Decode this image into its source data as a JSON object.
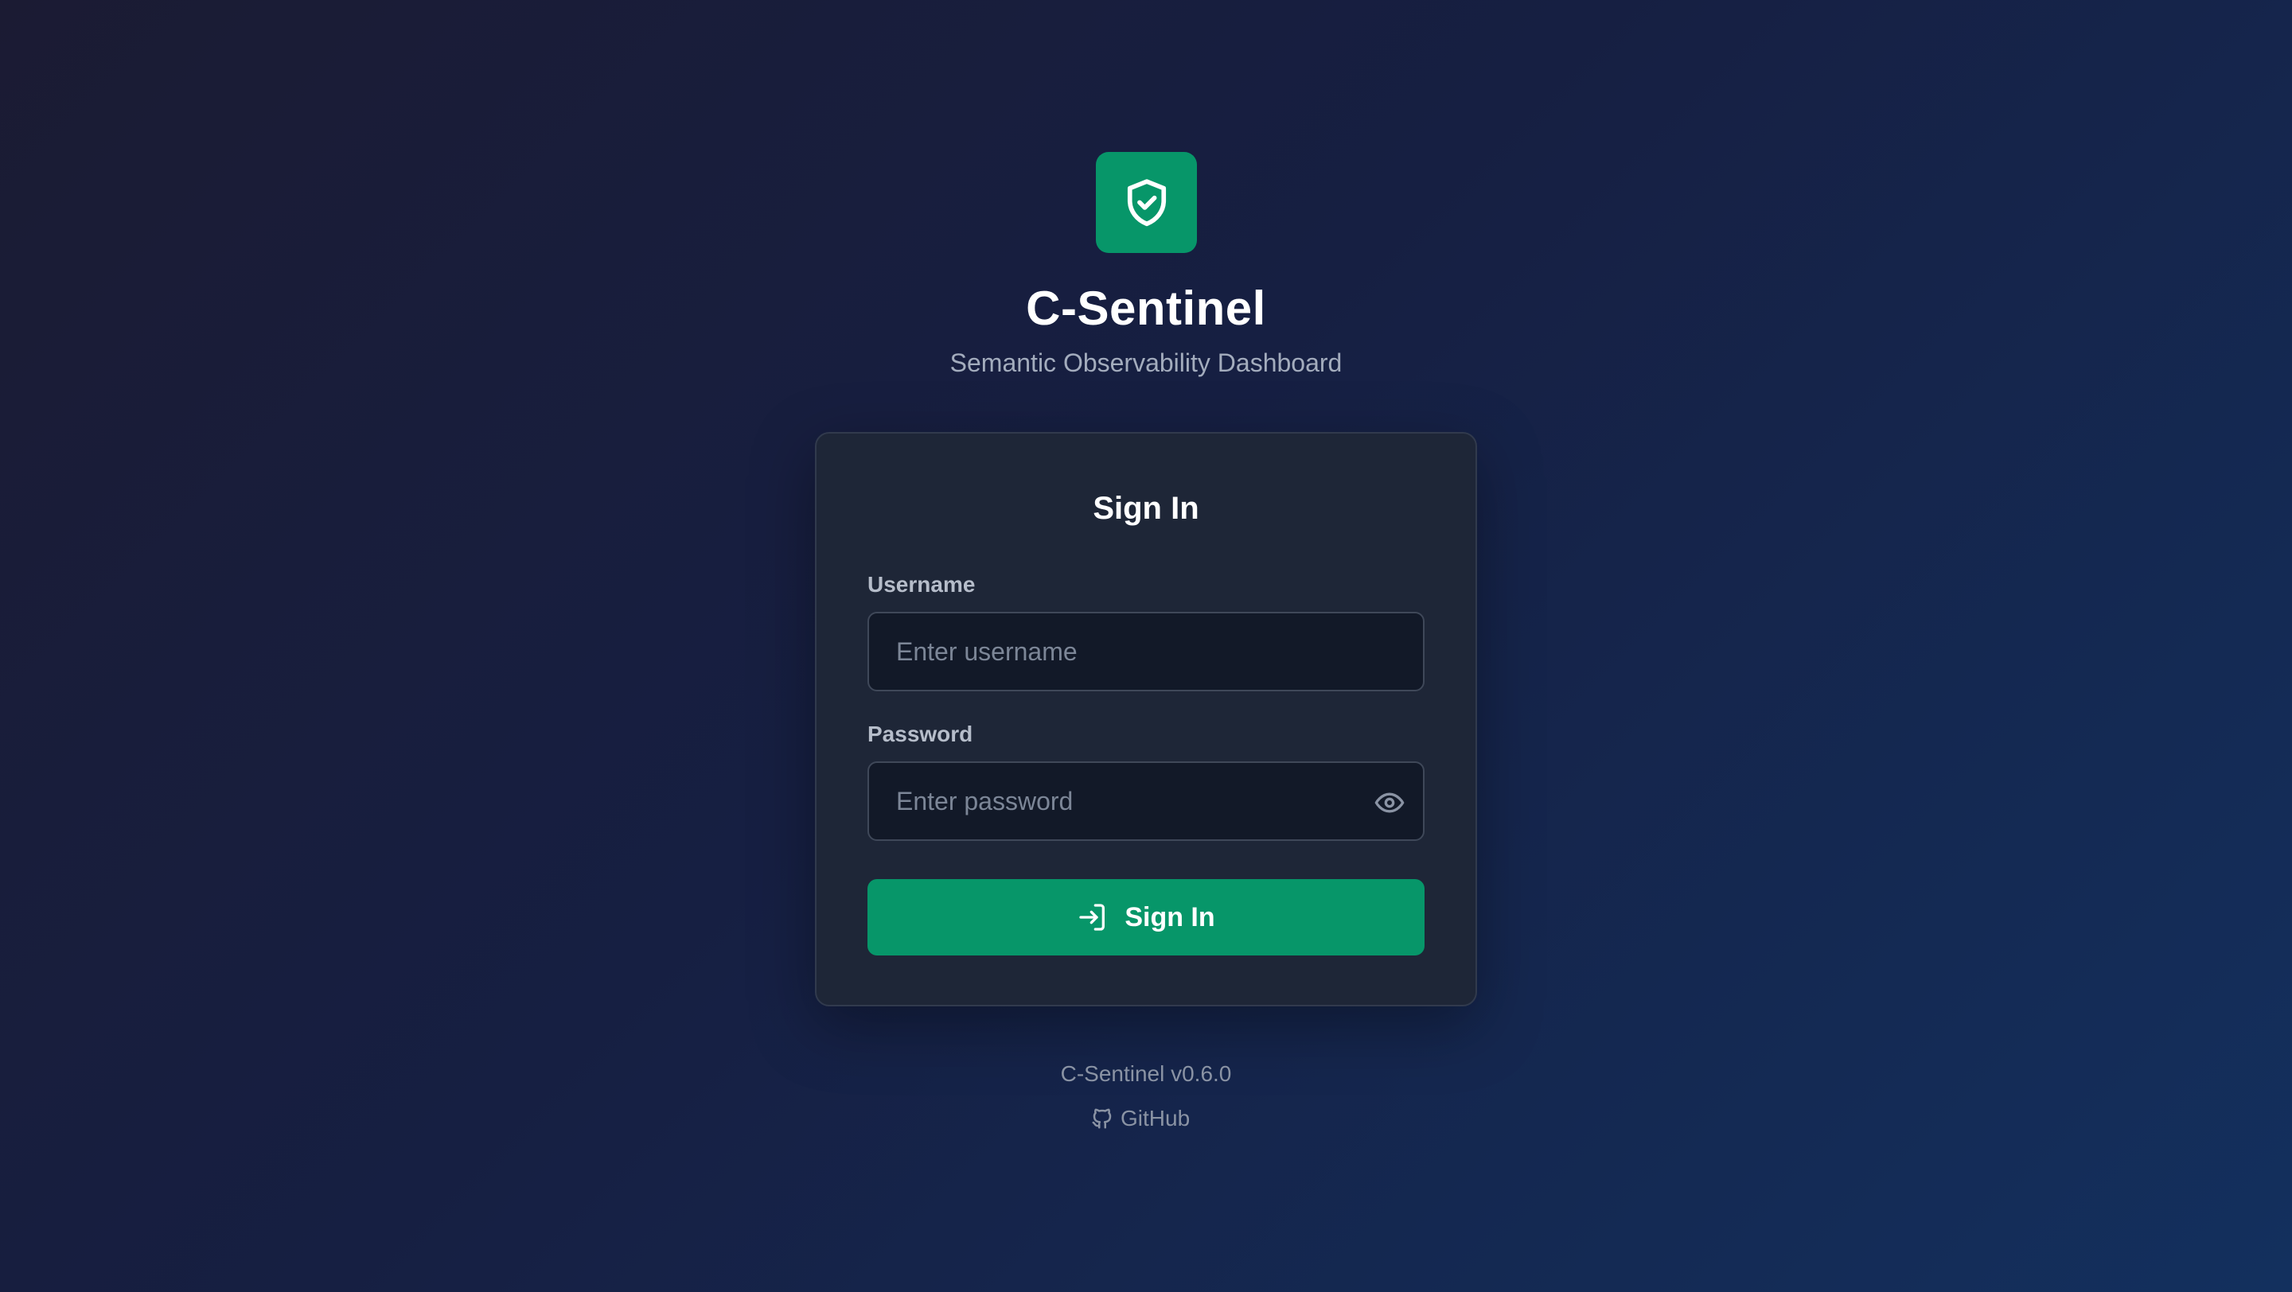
{
  "brand": {
    "logo_icon": "shield-check-icon",
    "title": "C-Sentinel",
    "subtitle": "Semantic Observability Dashboard"
  },
  "card": {
    "title": "Sign In",
    "username": {
      "label": "Username",
      "value": "",
      "placeholder": "Enter username"
    },
    "password": {
      "label": "Password",
      "value": "",
      "placeholder": "Enter password",
      "toggle_icon": "eye-icon"
    },
    "submit": {
      "icon": "sign-in-icon",
      "label": "Sign In"
    }
  },
  "footer": {
    "version": "C-Sentinel v0.6.0",
    "github": {
      "icon": "github-icon",
      "label": "GitHub"
    }
  },
  "colors": {
    "accent": "#079669",
    "card_background": "#1e2637",
    "input_background": "#121928"
  }
}
